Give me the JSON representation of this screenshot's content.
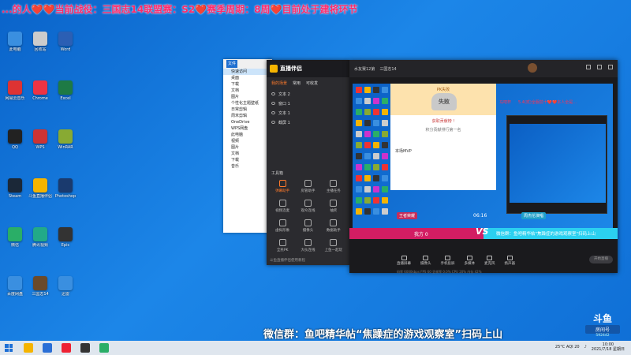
{
  "marquee": "...的人❤️❤️当前战役：三国志14联盟赛：S2❤️赛季周期：8周❤️目前处于建将环节",
  "desktop_icons": [
    {
      "label": "此电脑",
      "color": "#3a8fe0"
    },
    {
      "label": "网易云音乐",
      "color": "#d33"
    },
    {
      "label": "QQ",
      "color": "#222"
    },
    {
      "label": "Steam",
      "color": "#1b2838"
    },
    {
      "label": "微信",
      "color": "#2aae67"
    },
    {
      "label": "百度网盘",
      "color": "#3a8fe0"
    },
    {
      "label": "回收站",
      "color": "#ccc"
    },
    {
      "label": "Chrome",
      "color": "#e34"
    },
    {
      "label": "WPS",
      "color": "#c33"
    },
    {
      "label": "斗鱼直播伴侣",
      "color": "#f5b400"
    },
    {
      "label": "腾讯视频",
      "color": "#2a8"
    },
    {
      "label": "三国志14",
      "color": "#6a4a2a"
    },
    {
      "label": "Word",
      "color": "#2b5fb4"
    },
    {
      "label": "Excel",
      "color": "#1e7a45"
    },
    {
      "label": "WinRAR",
      "color": "#8a3"
    },
    {
      "label": "Photoshop",
      "color": "#1a3a6e"
    },
    {
      "label": "Epic",
      "color": "#333"
    },
    {
      "label": "迅雷",
      "color": "#3a8fe0"
    }
  ],
  "explorer": {
    "tab": "文件",
    "nav": [
      "快速访问",
      "桌面",
      "下载",
      "文档",
      "图片",
      "个性化主题壁纸",
      "日常剪辑",
      "周末剪辑",
      "OneDrive",
      "WPS网盘",
      "此电脑",
      "视频",
      "图片",
      "文档",
      "下载",
      "音乐"
    ]
  },
  "assistant": {
    "title": "直播伴侣",
    "tabs": [
      "我的场景",
      "常用",
      "可收发"
    ],
    "layers": [
      "文本 2",
      "窗口 1",
      "文本 1",
      "截屏 1"
    ],
    "tools_title": "工具箱",
    "tools": [
      "弹幕助手",
      "房管助手",
      "主播任务",
      "视频连麦",
      "观众连线",
      "抽奖",
      "虚拟形象",
      "摄像头",
      "数据助手",
      "全民PK",
      "大伙连线",
      "上鱼一起玩"
    ],
    "footer": "斗鱼直播伴侣使用教程"
  },
  "preview": {
    "top_tabs": [
      "水友赛12第",
      "三国志14"
    ],
    "pk": {
      "head": "PK失败",
      "result": "失败",
      "line1": "获取贡献榜 !",
      "line2": "积分贡献排行第一名",
      "mvp": "本场MVP"
    },
    "banner_left": "马吧杯",
    "banner_right": "5.4(贰)全服前十❤️❤️本人全是...",
    "left_user": "王者荣耀",
    "right_user": "周杰伦演唱",
    "timer": "06:16",
    "left_score": "我方 0",
    "right_score": "0 对方",
    "notice": "微信群：鱼吧精华帖\"焦躁症的游戏观察室\"扫码上山",
    "bottom_tools": [
      "直播屏幕",
      "摄像头",
      "手机投屏",
      "多媒体",
      "麦克风",
      "扬声器"
    ],
    "start_label": "开始直播",
    "status": "码率 6000kbps  FPS 60  丢帧率 0.0%  CPU 20%  内存 42%"
  },
  "caption": "微信群：鱼吧精华帖“焦躁症的游戏观察室”扫码上山",
  "brand": {
    "name": "斗鱼",
    "room": "房间号",
    "room_no": "592442"
  },
  "taskbar": {
    "weather": "25°C AQI 20",
    "time": "10:00",
    "date": "2021/7/18 星期日"
  }
}
